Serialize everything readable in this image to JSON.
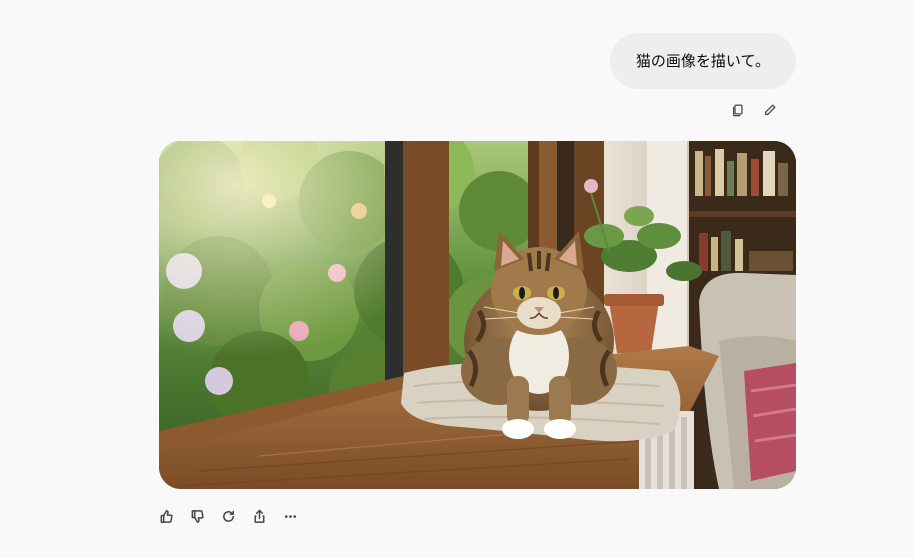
{
  "user_message": {
    "text": "猫の画像を描いて。"
  },
  "user_actions": [
    {
      "icon": "copy-icon"
    },
    {
      "icon": "edit-pencil-icon"
    }
  ],
  "generated_image": {
    "icon": "generated-cat-image"
  },
  "assistant_actions": [
    {
      "icon": "thumbs-up-icon"
    },
    {
      "icon": "thumbs-down-icon"
    },
    {
      "icon": "regenerate-icon"
    },
    {
      "icon": "share-icon"
    },
    {
      "icon": "more-options-icon"
    }
  ]
}
